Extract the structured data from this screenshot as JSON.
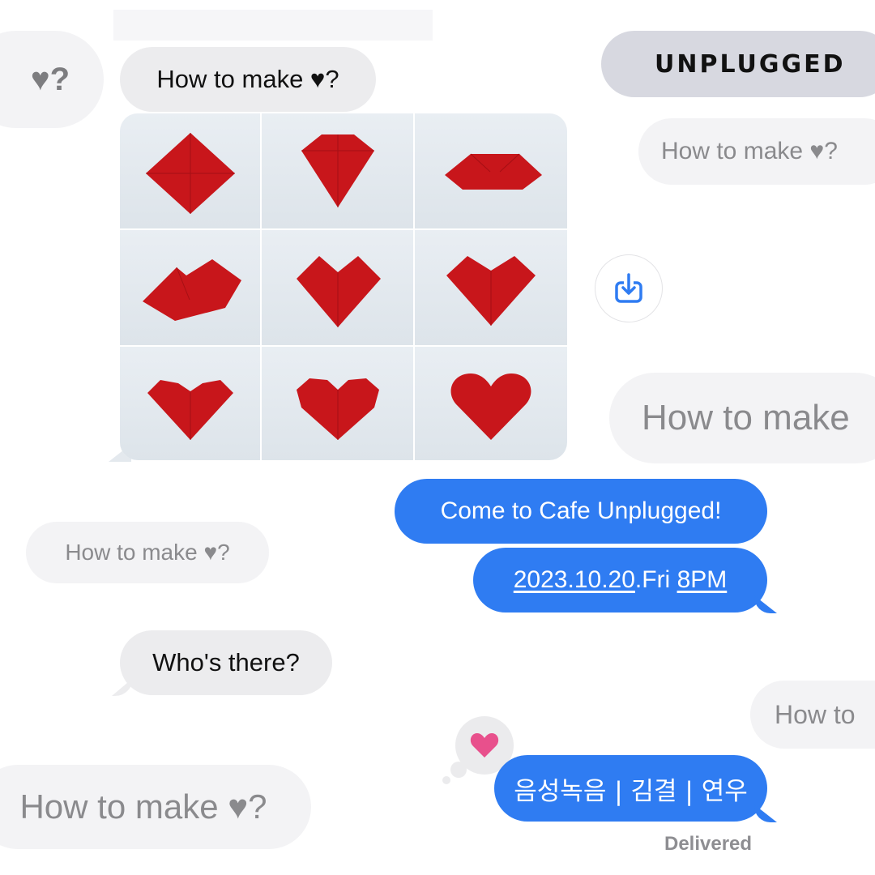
{
  "brand": {
    "label": "UNPLUGGED"
  },
  "messages": {
    "faded_left_top": "♥?",
    "how_to_main": "How to make ♥?",
    "faded_right_top": "How to make ♥?",
    "faded_right_mid": "How to make",
    "faded_left_mid": "How to make ♥?",
    "blue_line1": "Come to Cafe Unplugged!",
    "blue_line2_date": "2023.10.20",
    "blue_line2_day": ".Fri ",
    "blue_line2_time": "8PM",
    "whos_there": "Who's there?",
    "faded_right_bottom": "How to",
    "faded_left_bottom": "How to make ♥?",
    "blue_credits": "음성녹음 | 김결 | 연우",
    "status": "Delivered"
  },
  "icons": {
    "share": "share-download-icon",
    "reaction": "heart-icon",
    "paper_hearts": "origami-heart-step-images"
  },
  "colors": {
    "imessage_blue": "#2f7cf2",
    "received_grey": "#ececee",
    "origami_red": "#c8161b",
    "reaction_pink": "#e8508c"
  }
}
